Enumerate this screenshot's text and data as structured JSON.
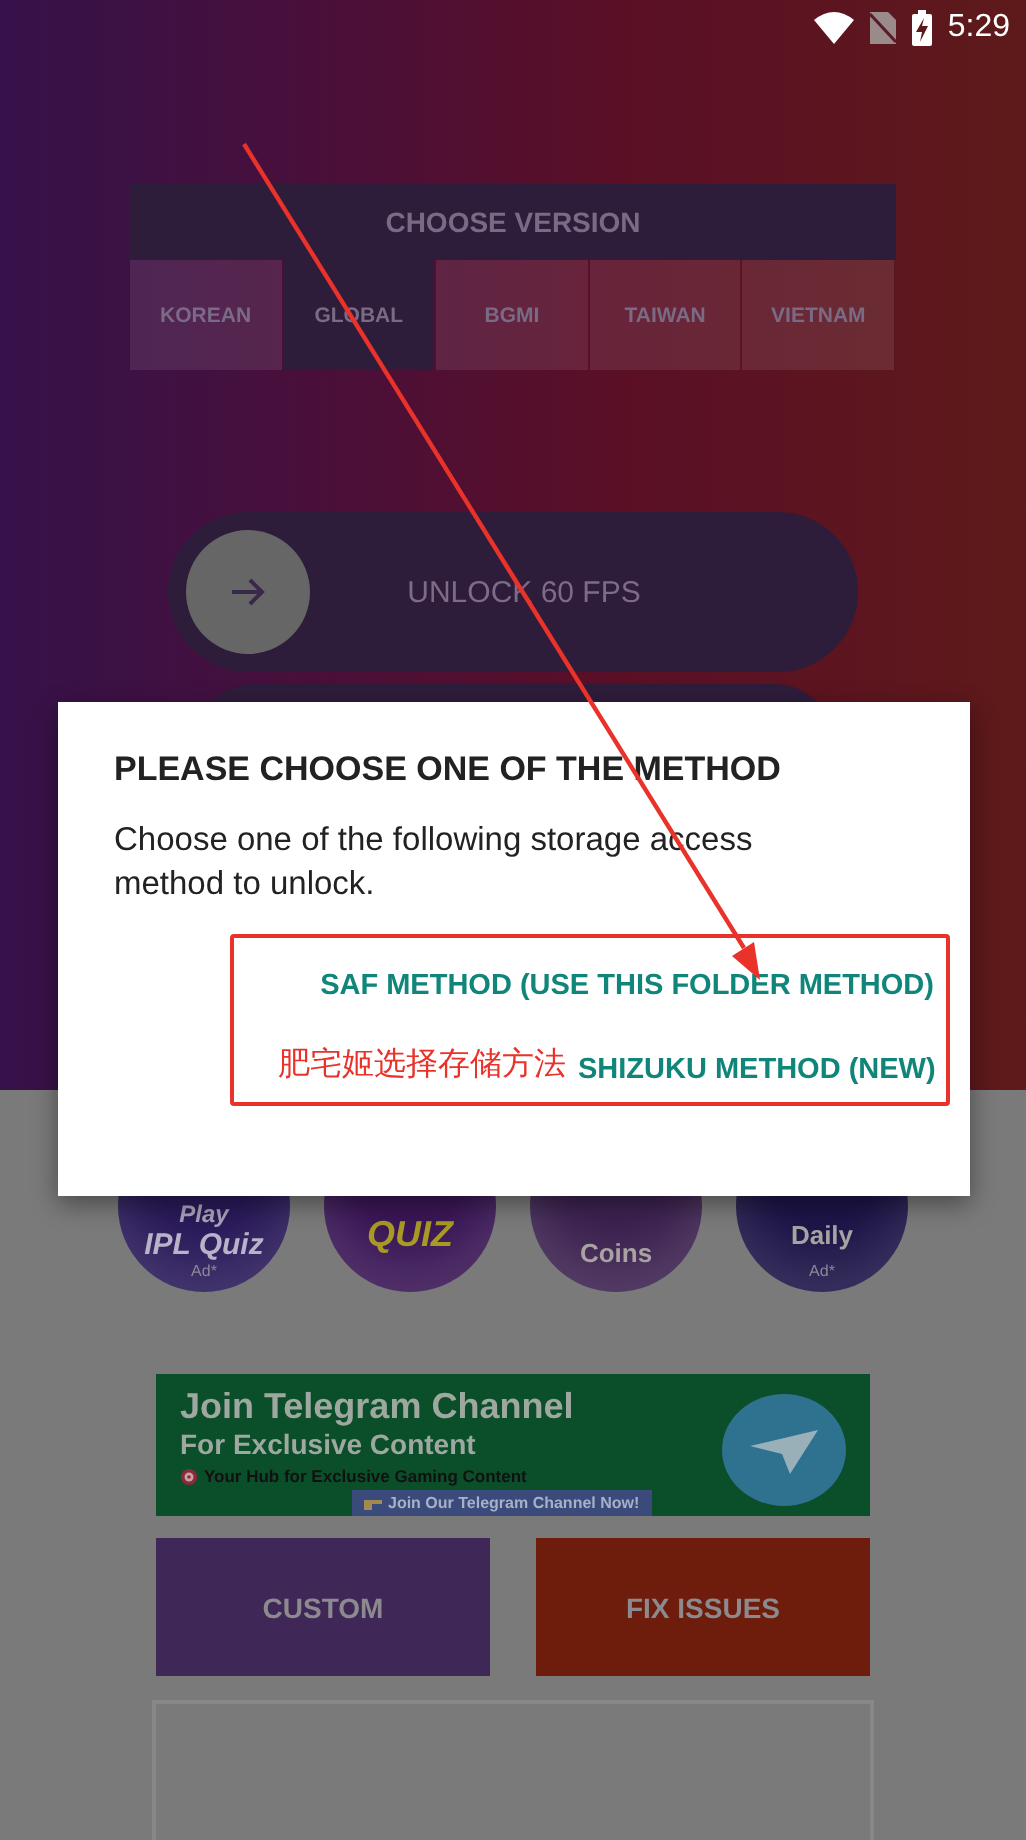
{
  "status_bar": {
    "time": "5:29"
  },
  "version_picker": {
    "title": "CHOOSE VERSION",
    "options": [
      {
        "label": "KOREAN",
        "selected": false
      },
      {
        "label": "GLOBAL",
        "selected": true
      },
      {
        "label": "BGMI",
        "selected": false
      },
      {
        "label": "TAIWAN",
        "selected": false
      },
      {
        "label": "VIETNAM",
        "selected": false
      }
    ]
  },
  "unlock_slider": {
    "label": "UNLOCK 60 FPS",
    "level": 0
  },
  "promo_tiles": [
    {
      "color": "#2a1a5a",
      "lines": [
        {
          "text": "Play",
          "kind": "small"
        },
        {
          "text": "IPL Quiz",
          "kind": "big"
        },
        {
          "text": "Ad*",
          "kind": "tiny"
        }
      ]
    },
    {
      "color": "#3a1656",
      "lines": [
        {
          "text": "QUIZ",
          "kind": "gold"
        }
      ]
    },
    {
      "color": "#3c2250",
      "lines": [
        {
          "text": "Coins",
          "kind": "plain"
        }
      ]
    },
    {
      "color": "#1d1548",
      "lines": [
        {
          "text": "Daily",
          "kind": "plain"
        },
        {
          "text": "Ad*",
          "kind": "tiny"
        }
      ]
    }
  ],
  "telegram_banner": {
    "title": "Join Telegram Channel",
    "subtitle": "For Exclusive Content",
    "tagline": "Your Hub for Exclusive Gaming Content",
    "cta": "Join Our Telegram Channel Now!"
  },
  "action_buttons": [
    {
      "label": "CUSTOM",
      "color": "#3f2858"
    },
    {
      "label": "FIX ISSUES",
      "color": "#6e1d0c"
    }
  ],
  "dialog": {
    "title": "PLEASE CHOOSE ONE OF THE METHOD",
    "message": "Choose one of the following storage access method to unlock.",
    "buttons": [
      "SAF METHOD (USE THIS FOLDER METHOD)",
      "SHIZUKU METHOD (NEW)"
    ]
  },
  "annotation": {
    "note": "肥宅姬选择存储方法"
  }
}
